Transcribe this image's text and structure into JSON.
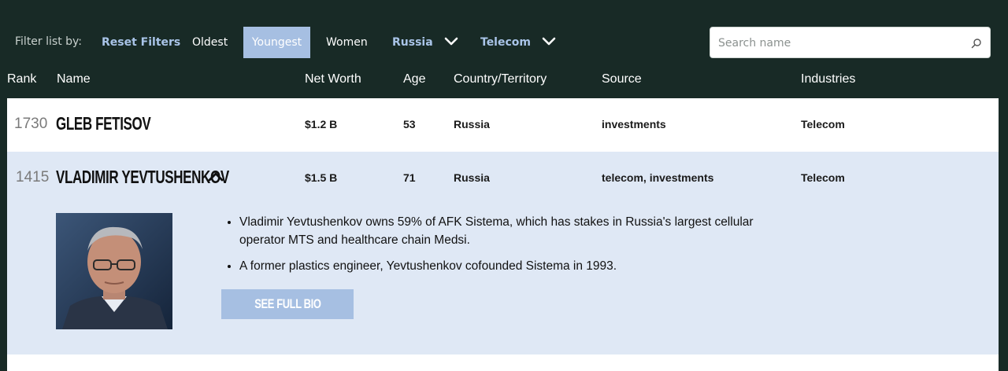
{
  "filters": {
    "label": "Filter list by:",
    "reset": "Reset Filters",
    "oldest": "Oldest",
    "youngest": "Youngest",
    "women": "Women",
    "country": "Russia",
    "industry": "Telecom"
  },
  "search": {
    "placeholder": "Search name"
  },
  "columns": {
    "rank": "Rank",
    "name": "Name",
    "net_worth": "Net Worth",
    "age": "Age",
    "country": "Country/Territory",
    "source": "Source",
    "industries": "Industries"
  },
  "rows": [
    {
      "rank": "1730",
      "name": "GLEB FETISOV",
      "net_worth": "$1.2 B",
      "age": "53",
      "country": "Russia",
      "source": "investments",
      "industries": "Telecom"
    },
    {
      "rank": "1415",
      "name": "VLADIMIR YEVTUSHENKOV",
      "net_worth": "$1.5 B",
      "age": "71",
      "country": "Russia",
      "source": "telecom, investments",
      "industries": "Telecom",
      "bullets": [
        "Vladimir Yevtushenkov owns 59% of AFK Sistema, which has stakes in Russia's largest cellular operator MTS and healthcare chain Medsi.",
        "A former plastics engineer, Yevtushenkov cofounded Sistema in 1993."
      ],
      "bio_button": "SEE FULL BIO"
    }
  ],
  "colors": {
    "header_bg": "#182a26",
    "accent": "#a6bfe2",
    "expanded_row_bg": "#dfe8f5"
  },
  "icons": {
    "dropdown": "chevron-down-icon",
    "search": "search-icon",
    "collapse": "chevron-up-icon"
  }
}
